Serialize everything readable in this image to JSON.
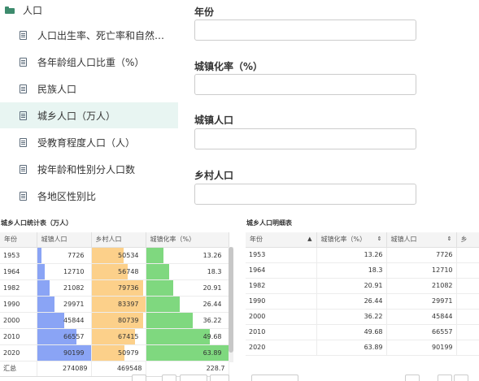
{
  "tree": {
    "root_label": "人口",
    "items": [
      {
        "label": "人口出生率、死亡率和自然…",
        "active": false
      },
      {
        "label": "各年龄组人口比重（%）",
        "active": false
      },
      {
        "label": "民族人口",
        "active": false
      },
      {
        "label": "城乡人口（万人）",
        "active": true
      },
      {
        "label": "受教育程度人口（人）",
        "active": false
      },
      {
        "label": "按年龄和性别分人口数",
        "active": false
      },
      {
        "label": "各地区性别比",
        "active": false
      }
    ]
  },
  "form": {
    "fields": [
      {
        "label": "年份",
        "value": ""
      },
      {
        "label": "城镇化率（%）",
        "value": ""
      },
      {
        "label": "城镇人口",
        "value": ""
      },
      {
        "label": "乡村人口",
        "value": ""
      }
    ]
  },
  "stats_table": {
    "title": "城乡人口统计表（万人）",
    "columns": [
      "年份",
      "城镇人口",
      "乡村人口",
      "城镇化率（%）"
    ],
    "bar_colors": {
      "urban": "#8aa4f5",
      "rural": "#fcd08a",
      "rate": "#7fd87f"
    },
    "rows": [
      {
        "year": "1953",
        "urban": 7726,
        "rural": 50534,
        "rate": 13.26
      },
      {
        "year": "1964",
        "urban": 12710,
        "rural": 56748,
        "rate": 18.3
      },
      {
        "year": "1982",
        "urban": 21082,
        "rural": 79736,
        "rate": 20.91
      },
      {
        "year": "1990",
        "urban": 29971,
        "rural": 83397,
        "rate": 26.44
      },
      {
        "year": "2000",
        "urban": 45844,
        "rural": 80739,
        "rate": 36.22
      },
      {
        "year": "2010",
        "urban": 66557,
        "rural": 67415,
        "rate": 49.68
      },
      {
        "year": "2020",
        "urban": 90199,
        "rural": 50979,
        "rate": 63.89
      }
    ],
    "summary": {
      "label": "汇总",
      "urban": "274089",
      "rural": "469548",
      "rate": "228.7"
    }
  },
  "detail_table": {
    "title": "城乡人口明细表",
    "columns": [
      "年份",
      "城镇化率（%）",
      "城镇人口",
      "乡"
    ],
    "rows": [
      {
        "year": "1953",
        "rate": "13.26",
        "urban": "7726"
      },
      {
        "year": "1964",
        "rate": "18.3",
        "urban": "12710"
      },
      {
        "year": "1982",
        "rate": "20.91",
        "urban": "21082"
      },
      {
        "year": "1990",
        "rate": "26.44",
        "urban": "29971"
      },
      {
        "year": "2000",
        "rate": "36.22",
        "urban": "45844"
      },
      {
        "year": "2010",
        "rate": "49.68",
        "urban": "66557"
      },
      {
        "year": "2020",
        "rate": "63.89",
        "urban": "90199"
      }
    ]
  }
}
